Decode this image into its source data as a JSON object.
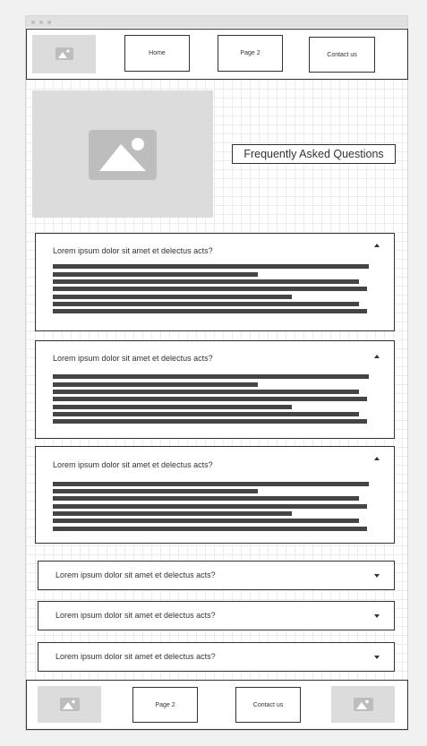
{
  "nav": {
    "items": [
      "Home",
      "Page 2",
      "Contact us"
    ]
  },
  "hero": {
    "title": "Frequently Asked Questions"
  },
  "faq": {
    "items": [
      {
        "question": "Lorem ipsum dolor sit amet et delectus acts?",
        "expanded": true
      },
      {
        "question": "Lorem ipsum dolor sit amet et delectus acts?",
        "expanded": true
      },
      {
        "question": "Lorem ipsum dolor sit amet et delectus acts?",
        "expanded": true
      },
      {
        "question": "Lorem ipsum dolor sit amet et delectus acts?",
        "expanded": false
      },
      {
        "question": "Lorem ipsum dolor sit amet et delectus acts?",
        "expanded": false
      },
      {
        "question": "Lorem ipsum dolor sit amet et delectus acts?",
        "expanded": false
      }
    ]
  },
  "footer": {
    "items": [
      "Page 2",
      "Contact us"
    ]
  },
  "icons": {
    "image_placeholder": "image-icon",
    "chevron_up": "chevron-up-icon",
    "chevron_down": "chevron-down-icon"
  }
}
